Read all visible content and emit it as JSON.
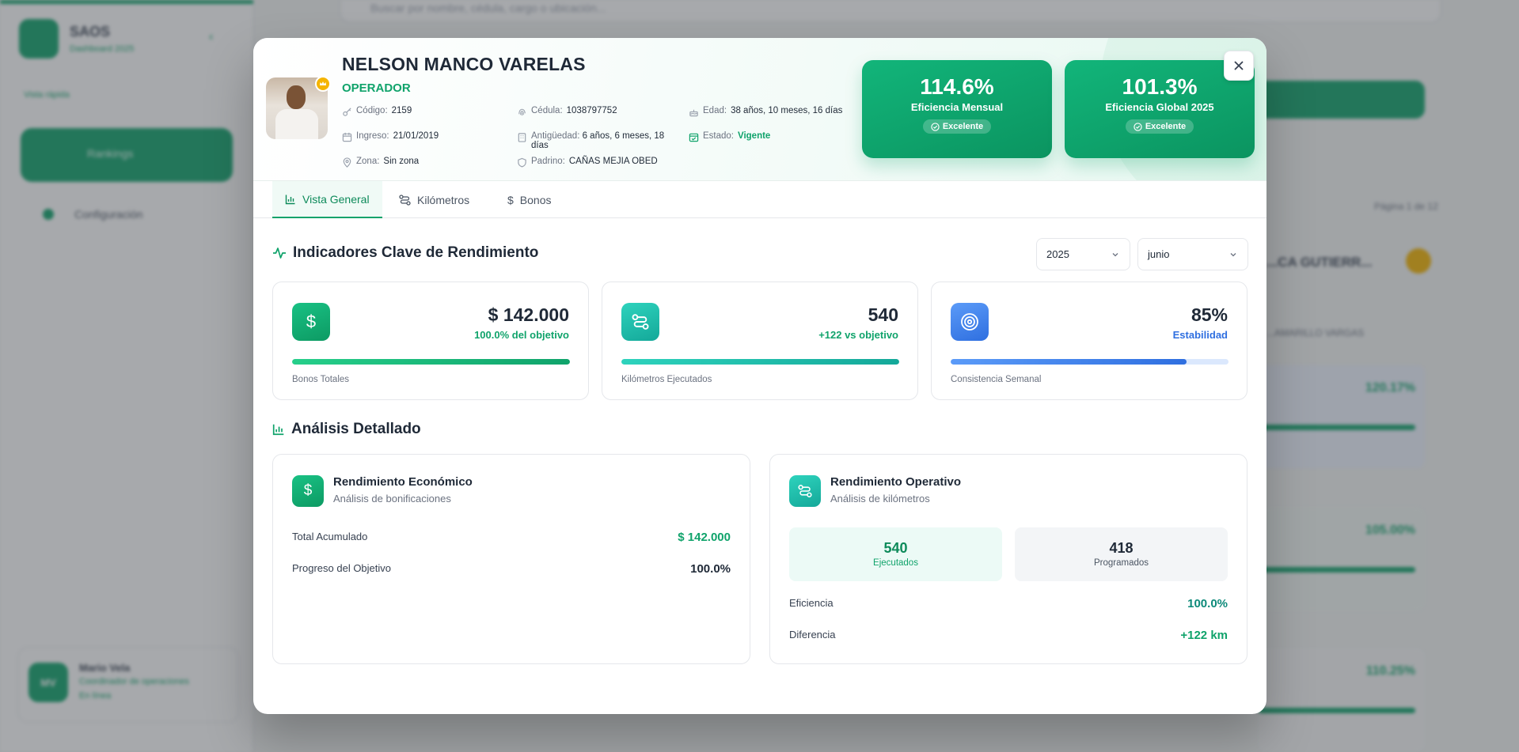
{
  "background": {
    "app_name": "SAOS",
    "app_subtitle": "Dashboard 2025",
    "sidebar_link": "Vista rápida",
    "nav_active": "Rankings",
    "nav_config": "Configuración",
    "search_placeholder": "Buscar por nombre, cédula, cargo o ubicación...",
    "pagination": "Página 1 de 12",
    "bg_person_name": "...CA GUTIERR...",
    "bg_person_sub": "...AMARILLO VARGAS",
    "bg_pct_1": "120.17%",
    "bg_pct_2": "105.00%",
    "bg_pct_3": "110.25%",
    "user_initials": "MV",
    "user_name": "Mario Vela",
    "user_role": "Coordinador de operaciones",
    "user_status": "En línea"
  },
  "profile": {
    "name": "NELSON MANCO VARELAS",
    "role": "OPERADOR",
    "codigo_label": "Código:",
    "codigo": "2159",
    "cedula_label": "Cédula:",
    "cedula": "1038797752",
    "edad_label": "Edad:",
    "edad": "38 años, 10 meses, 16 días",
    "ingreso_label": "Ingreso:",
    "ingreso": "21/01/2019",
    "antiguedad_label": "Antigüedad:",
    "antiguedad": "6 años, 6 meses, 18 días",
    "estado_label": "Estado:",
    "estado": "Vigente",
    "zona_label": "Zona:",
    "zona": "Sin zona",
    "padrino_label": "Padrino:",
    "padrino": "CAÑAS MEJIA OBED"
  },
  "efficiency": {
    "monthly_value": "114.6%",
    "monthly_label": "Eficiencia Mensual",
    "monthly_badge": "Excelente",
    "global_value": "101.3%",
    "global_label": "Eficiencia Global 2025",
    "global_badge": "Excelente"
  },
  "tabs": [
    {
      "label": "Vista General",
      "active": true
    },
    {
      "label": "Kilómetros",
      "active": false
    },
    {
      "label": "Bonos",
      "active": false
    }
  ],
  "kpi_section": {
    "title": "Indicadores Clave de Rendimiento",
    "year": "2025",
    "month": "junio"
  },
  "kpis": [
    {
      "value": "$ 142.000",
      "sub": "100.0% del objetivo",
      "label": "Bonos Totales",
      "progress": 1.0,
      "color": "#10a36b"
    },
    {
      "value": "540",
      "sub": "+122 vs objetivo",
      "label": "Kilómetros Ejecutados",
      "progress": 1.0,
      "color": "#14b8a6"
    },
    {
      "value": "85%",
      "sub": "Estabilidad",
      "label": "Consistencia Semanal",
      "progress": 0.85,
      "color": "#3b82f6"
    }
  ],
  "detail_section": {
    "title": "Análisis Detallado"
  },
  "economic": {
    "title": "Rendimiento Económico",
    "subtitle": "Análisis de bonificaciones",
    "total_label": "Total Acumulado",
    "total_value": "$ 142.000",
    "progress_label": "Progreso del Objetivo",
    "progress_value": "100.0%"
  },
  "operative": {
    "title": "Rendimiento Operativo",
    "subtitle": "Análisis de kilómetros",
    "executed_value": "540",
    "executed_label": "Ejecutados",
    "scheduled_value": "418",
    "scheduled_label": "Programados",
    "efficiency_label": "Eficiencia",
    "efficiency_value": "100.0%",
    "difference_label": "Diferencia",
    "difference_value": "+122 km"
  },
  "colors": {
    "accent": "#10a36b",
    "teal": "#14b8a6",
    "blue": "#3b82f6"
  }
}
